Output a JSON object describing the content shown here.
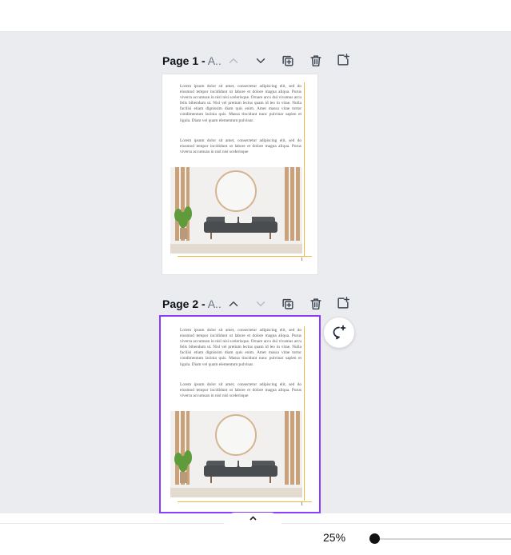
{
  "pages": [
    {
      "number_label": "Page 1 -",
      "name": "A..",
      "can_move_up": false,
      "can_move_down": true,
      "selected": false,
      "paragraph1": "Lorem ipsum dolor sit amet, consectetur adipiscing elit, sed do eiusmod tempor incididunt ut labore et dolore magna aliqua. Purus viverra accumsan in nisl nisi scelerisque. Ornare arcu dui vivamus arcu felis bibendum ut. Nisl vel pretium lectus quam id leo in vitae. Nulla facilisi etiam dignissim diam quis enim. Amet massa vitae tortor condimentum lacinia quis. Massa tincidunt nunc pulvinar sapien et ligula. Diam vel quam elementum pulvinar.",
      "paragraph2": "Lorem ipsum dolor sit amet, consectetur adipiscing elit, sed do eiusmod tempor incididunt ut labore et dolore magna aliqua. Purus viverra accumsan in nisl nisi scelerisque",
      "page_number": "1"
    },
    {
      "number_label": "Page 2 -",
      "name": "A..",
      "can_move_up": true,
      "can_move_down": false,
      "selected": true,
      "paragraph1": "Lorem ipsum dolor sit amet, consectetur adipiscing elit, sed do eiusmod tempor incididunt ut labore et dolore magna aliqua. Purus viverra accumsan in nisl nisi scelerisque. Ornare arcu dui vivamus arcu felis bibendum ut. Nisl vel pretium lectus quam id leo in vitae. Nulla facilisi etiam dignissim diam quis enim. Amet massa vitae tortor condimentum lacinia quis. Massa tincidunt nunc pulvinar sapien et ligula. Diam vel quam elementum pulvinar.",
      "paragraph2": "Lorem ipsum dolor sit amet, consectetur adipiscing elit, sed do eiusmod tempor incididunt ut labore et dolore magna aliqua. Purus viverra accumsan in nisl nisi scelerisque",
      "page_number": "1"
    }
  ],
  "page_actions": {
    "move_up_icon": "chevron-up-icon",
    "move_down_icon": "chevron-down-icon",
    "duplicate_icon": "duplicate-page-icon",
    "delete_icon": "trash-icon",
    "add_icon": "add-page-icon"
  },
  "comment": {
    "icon": "add-comment-icon"
  },
  "footer": {
    "scroll_icon": "chevron-up-icon",
    "zoom_label": "25%",
    "zoom_fraction": 0.25
  },
  "colors": {
    "selection": "#8b3dff",
    "guide": "#f3b53f",
    "canvas_bg": "#ebecf0"
  }
}
